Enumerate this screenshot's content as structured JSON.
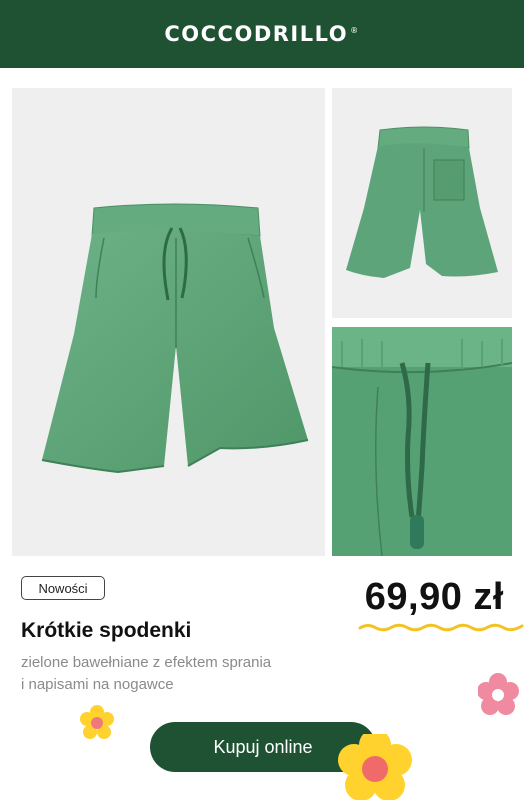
{
  "header": {
    "brand": "COCCODRILLO",
    "registered": "®",
    "background": "#1e5233"
  },
  "product": {
    "badge": "Nowości",
    "price": "69,90 zł",
    "name": "Krótkie spodenki",
    "description_line1": "zielone bawełniane z efektem sprania",
    "description_line2": "i napisami na nogawce",
    "cta": "Kupuj online"
  },
  "colors": {
    "accent": "#1e5233",
    "product_green": "#5ea47a",
    "squiggle": "#f3c324",
    "flower_pink": "#f08aa0",
    "flower_yellow": "#ffd22e"
  }
}
